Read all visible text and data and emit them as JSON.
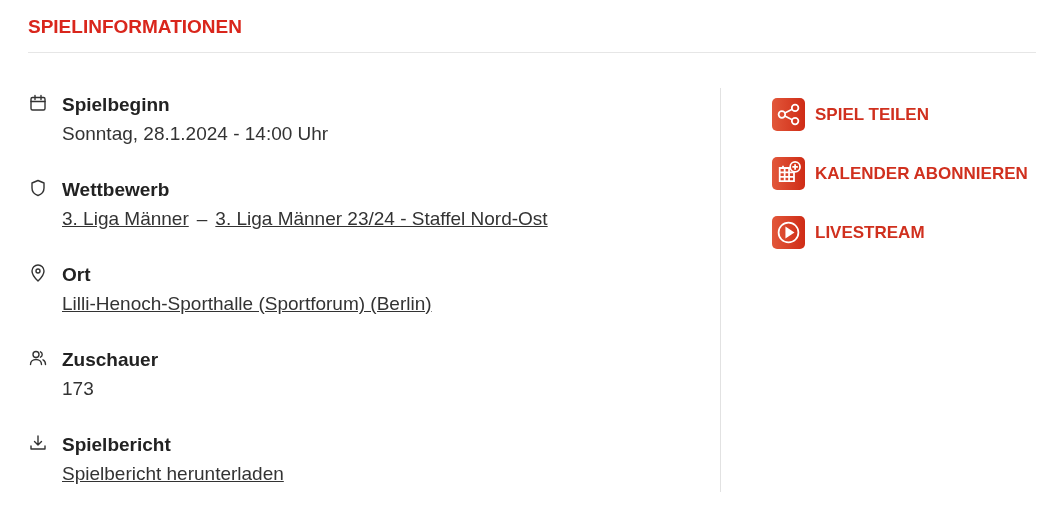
{
  "title": "SPIELINFORMATIONEN",
  "info": [
    {
      "kind": "calendar",
      "label": "Spielbeginn",
      "value": [
        {
          "kind": "text",
          "text": "Sonntag, 28.1.2024 - 14:00 Uhr"
        }
      ]
    },
    {
      "kind": "shield",
      "label": "Wettbewerb",
      "value": [
        {
          "kind": "link",
          "text": "3. Liga Männer"
        },
        {
          "kind": "text",
          "text": "–"
        },
        {
          "kind": "link",
          "text": "3. Liga Männer 23/24 - Staffel Nord-Ost"
        }
      ]
    },
    {
      "kind": "pin",
      "label": "Ort",
      "value": [
        {
          "kind": "link",
          "text": "Lilli-Henoch-Sporthalle (Sportforum) (Berlin)"
        }
      ]
    },
    {
      "kind": "people",
      "label": "Zuschauer",
      "value": [
        {
          "kind": "text",
          "text": "173"
        }
      ]
    },
    {
      "kind": "download",
      "label": "Spielbericht",
      "value": [
        {
          "kind": "link",
          "text": "Spielbericht herunterladen"
        }
      ]
    }
  ],
  "actions": [
    {
      "kind": "share",
      "label": "SPIEL TEILEN"
    },
    {
      "kind": "calendar-add",
      "label": "KALENDER ABONNIEREN"
    },
    {
      "kind": "play",
      "label": "LIVESTREAM"
    }
  ]
}
